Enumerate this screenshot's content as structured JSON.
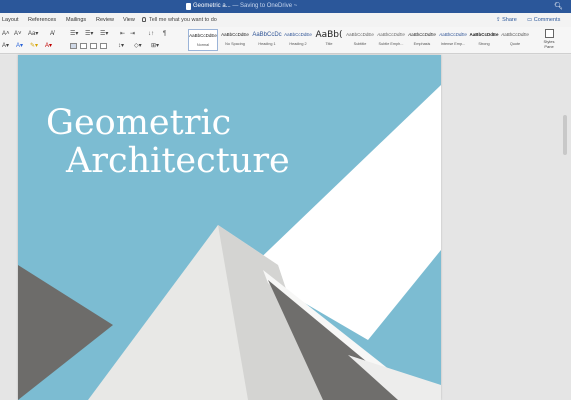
{
  "window": {
    "title": "Geometric a...",
    "title_suffix": " — Saving to OneDrive ~"
  },
  "tabs": [
    {
      "label": "Layout"
    },
    {
      "label": "References"
    },
    {
      "label": "Mailings"
    },
    {
      "label": "Review"
    },
    {
      "label": "View"
    }
  ],
  "tell_me": {
    "placeholder": "Tell me what you want to do"
  },
  "share": {
    "label": "Share"
  },
  "comments": {
    "label": "Comments"
  },
  "styles": [
    {
      "sample": "AaBbCcDdEe",
      "name": "Normal"
    },
    {
      "sample": "AaBbCcDdEe",
      "name": "No Spacing"
    },
    {
      "sample": "AaBbCcDc",
      "name": "Heading 1"
    },
    {
      "sample": "AaBbCcDdEe",
      "name": "Heading 2"
    },
    {
      "sample": "AaBb(",
      "name": "Title"
    },
    {
      "sample": "AaBbCcDdEe",
      "name": "Subtitle"
    },
    {
      "sample": "AaBbCcDdEe",
      "name": "Subtle Emph..."
    },
    {
      "sample": "AaBbCcDdEe",
      "name": "Emphasis"
    },
    {
      "sample": "AaBbCcDdEe",
      "name": "Intense Emp..."
    },
    {
      "sample": "AaBbCcDdEe",
      "name": "Strong"
    },
    {
      "sample": "AaBbCcDdEe",
      "name": "Quote"
    }
  ],
  "styles_pane": {
    "label_line1": "Styles",
    "label_line2": "Pane"
  },
  "document": {
    "title_line1": "Geometric",
    "title_line2": "Architecture"
  },
  "colors": {
    "sky": "#7cbcd2",
    "accent": "#2b579a",
    "roof_light": "#e9e9e8",
    "roof_dark": "#6f6e6c"
  }
}
